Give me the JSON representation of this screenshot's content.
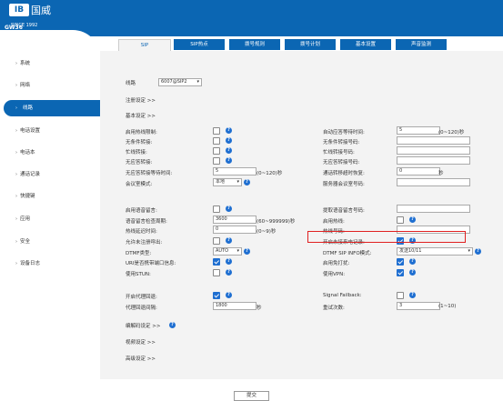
{
  "brand": {
    "logo": "IB",
    "name_cn": "国威",
    "since": "SINCE 1992",
    "model": "GW36"
  },
  "sidebar": {
    "items": [
      {
        "label": "系统"
      },
      {
        "label": "网络"
      },
      {
        "label": "线路"
      },
      {
        "label": "电话设置"
      },
      {
        "label": "电话本"
      },
      {
        "label": "通话记录"
      },
      {
        "label": "快捷键"
      },
      {
        "label": "应用"
      },
      {
        "label": "安全"
      },
      {
        "label": "设备日志"
      }
    ],
    "active_index": 2
  },
  "tabs": [
    {
      "label": "SIP"
    },
    {
      "label": "SIP热点"
    },
    {
      "label": "拨号规则"
    },
    {
      "label": "拨号计划"
    },
    {
      "label": "基本设置"
    },
    {
      "label": "声音监测"
    }
  ],
  "line": {
    "label": "线路",
    "value": "6007@SIP2"
  },
  "sections": {
    "register": "注册设定 >>",
    "basic": "基本设定 >>",
    "codec": "编解码设定 >>",
    "video": "视频设定 >>",
    "advanced": "高级设定 >>"
  },
  "left_fields": [
    {
      "label": "启用热线限制:",
      "type": "checkbox",
      "checked": false
    },
    {
      "label": "无条件转接:",
      "type": "checkbox",
      "checked": false
    },
    {
      "label": "忙线转接:",
      "type": "checkbox",
      "checked": false
    },
    {
      "label": "无应答转接:",
      "type": "checkbox",
      "checked": false
    },
    {
      "label": "无应答转接等待时间:",
      "type": "input",
      "value": "5",
      "unit": "(0~120)秒"
    },
    {
      "label": "会议室模式:",
      "type": "select",
      "value": "本地"
    },
    {
      "label": "启用语音留言:",
      "type": "checkbox",
      "checked": false
    },
    {
      "label": "语音留言检查周期:",
      "type": "input",
      "value": "3600",
      "unit": "(60~999999)秒"
    },
    {
      "label": "热线延迟时间:",
      "type": "input",
      "value": "0",
      "unit": "(0~9)秒"
    },
    {
      "label": "允许未注册呼出:",
      "type": "checkbox",
      "checked": false
    },
    {
      "label": "DTMF类型:",
      "type": "select",
      "value": "AUTO"
    },
    {
      "label": "URI是否携带端口信息:",
      "type": "checkbox",
      "checked": true
    },
    {
      "label": "使用STUN:",
      "type": "checkbox",
      "checked": false
    },
    {
      "label": "开启代理回退:",
      "type": "checkbox",
      "checked": true
    },
    {
      "label": "代理回退间隔:",
      "type": "input",
      "value": "1800",
      "unit": "秒"
    }
  ],
  "right_fields": [
    {
      "label": "自动应答等待时间:",
      "type": "input",
      "value": "5",
      "unit": "(0~120)秒"
    },
    {
      "label": "无条件转接号码:",
      "type": "input",
      "value": ""
    },
    {
      "label": "忙线转接号码:",
      "type": "input",
      "value": ""
    },
    {
      "label": "无应答转接号码:",
      "type": "input",
      "value": ""
    },
    {
      "label": "通话转移超时恢复:",
      "type": "input",
      "value": "0",
      "unit": "秒"
    },
    {
      "label": "服务器会议室号码:",
      "type": "input",
      "value": ""
    },
    {
      "label": "提取语音留言号码:",
      "type": "input",
      "value": ""
    },
    {
      "label": "启用热线:",
      "type": "checkbox",
      "checked": false
    },
    {
      "label": "热线号码:",
      "type": "input",
      "value": ""
    },
    {
      "label": "开启未接来电记录:",
      "type": "checkbox",
      "checked": true
    },
    {
      "label": "DTMF SIP INFO模式:",
      "type": "select",
      "value": "发送10/11"
    },
    {
      "label": "启用免打扰:",
      "type": "checkbox",
      "checked": true
    },
    {
      "label": "使用VPN:",
      "type": "checkbox",
      "checked": true
    },
    {
      "label": "Signal Failback:",
      "type": "checkbox",
      "checked": false
    },
    {
      "label": "重试次数:",
      "type": "input",
      "value": "3",
      "unit": "(1~10)"
    }
  ],
  "submit_label": "提交",
  "colors": {
    "primary": "#0b66b3",
    "highlight": "#e02020",
    "checkbox": "#1f6fd1"
  }
}
